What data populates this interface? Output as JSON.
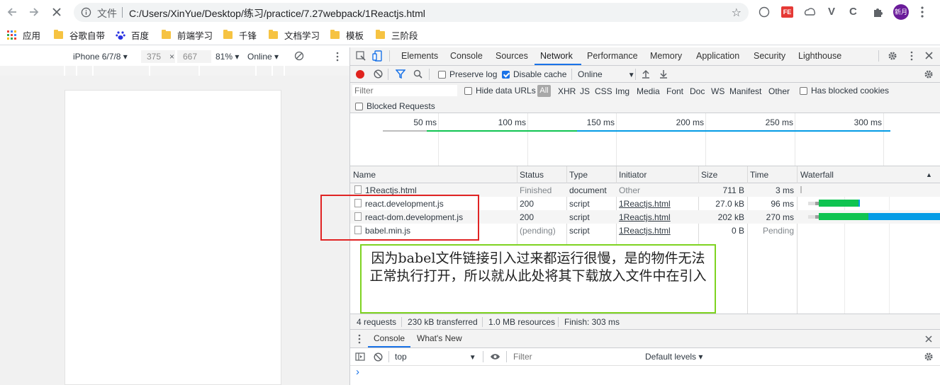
{
  "browser": {
    "address_label": "文件",
    "url": "C:/Users/XinYue/Desktop/练习/practice/7.27webpack/1Reactjs.html",
    "profile_label": "新月"
  },
  "bookmarks": [
    "应用",
    "谷歌自带",
    "百度",
    "前端学习",
    "千锋",
    "文档学习",
    "模板",
    "三阶段"
  ],
  "device_toolbar": {
    "device": "iPhone 6/7/8",
    "width": "375",
    "times": "×",
    "height": "667",
    "zoom": "81%",
    "throttle": "Online"
  },
  "devtools": {
    "tabs": [
      "Elements",
      "Console",
      "Sources",
      "Network",
      "Performance",
      "Memory",
      "Application",
      "Security",
      "Lighthouse"
    ],
    "active_tab": "Network"
  },
  "network_toolbar": {
    "preserve_log": "Preserve log",
    "disable_cache": "Disable cache",
    "throttle": "Online"
  },
  "filter_bar": {
    "placeholder": "Filter",
    "hide_data_urls": "Hide data URLs",
    "types": [
      "All",
      "XHR",
      "JS",
      "CSS",
      "Img",
      "Media",
      "Font",
      "Doc",
      "WS",
      "Manifest",
      "Other"
    ],
    "has_blocked_cookies": "Has blocked cookies",
    "blocked_requests": "Blocked Requests"
  },
  "overview_ticks": [
    "50 ms",
    "100 ms",
    "150 ms",
    "200 ms",
    "250 ms",
    "300 ms"
  ],
  "table": {
    "columns": [
      "Name",
      "Status",
      "Type",
      "Initiator",
      "Size",
      "Time",
      "Waterfall"
    ],
    "rows": [
      {
        "name": "1Reactjs.html",
        "status": "Finished",
        "type": "document",
        "initiator": "Other",
        "size": "711 B",
        "time": "3 ms"
      },
      {
        "name": "react.development.js",
        "status": "200",
        "type": "script",
        "initiator": "1Reactjs.html",
        "size": "27.0 kB",
        "time": "96 ms"
      },
      {
        "name": "react-dom.development.js",
        "status": "200",
        "type": "script",
        "initiator": "1Reactjs.html",
        "size": "202 kB",
        "time": "270 ms"
      },
      {
        "name": "babel.min.js",
        "status": "(pending)",
        "type": "script",
        "initiator": "1Reactjs.html",
        "size": "0 B",
        "time": "Pending"
      }
    ]
  },
  "summary": {
    "requests": "4 requests",
    "transferred": "230 kB transferred",
    "resources": "1.0 MB resources",
    "finish": "Finish: 303 ms"
  },
  "drawer": {
    "tabs": [
      "Console",
      "What's New"
    ],
    "context": "top",
    "filter_placeholder": "Filter",
    "levels": "Default levels ▾",
    "prompt": "›"
  },
  "annotation": {
    "text": "因为babel文件链接引入过来都运行很慢，是的物件无法正常执行打开，所以就从此处将其下载放入文件中在引入"
  },
  "colors": {
    "accent": "#1a73e8",
    "record": "#e0231e",
    "waterfall_green": "#0fc451",
    "waterfall_blue": "#039be5",
    "annotation_red": "#e02424",
    "annotation_green": "#7ed321"
  }
}
